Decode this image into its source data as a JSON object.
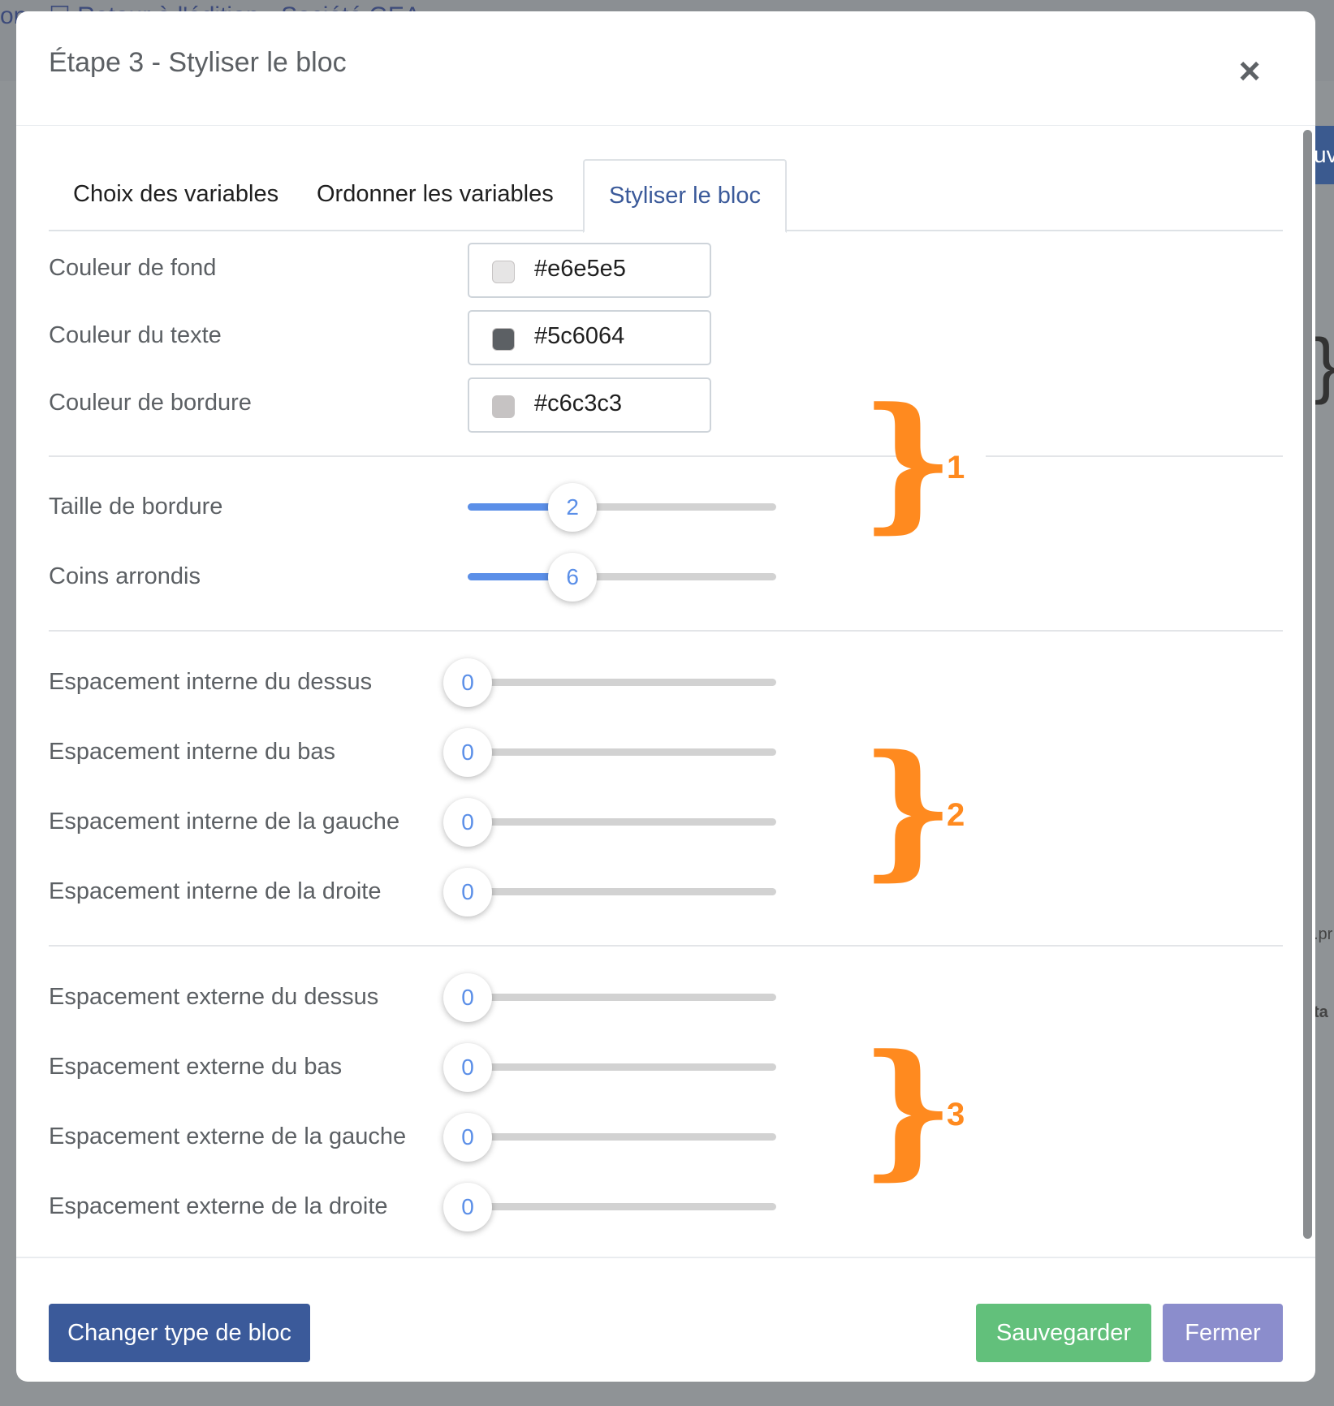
{
  "modal": {
    "title": "Étape 3 - Styliser le bloc",
    "close_icon": "×"
  },
  "tabs": [
    {
      "label": "Choix des variables",
      "active": false
    },
    {
      "label": "Ordonner les variables",
      "active": false
    },
    {
      "label": "Styliser le bloc",
      "active": true
    }
  ],
  "colors": [
    {
      "label": "Couleur de fond",
      "value": "#e6e5e5",
      "swatch": "#e6e5e5"
    },
    {
      "label": "Couleur du texte",
      "value": "#5c6064",
      "swatch": "#5c6064"
    },
    {
      "label": "Couleur de bordure",
      "value": "#c6c3c3",
      "swatch": "#c6c3c3"
    }
  ],
  "border_sliders": [
    {
      "label": "Taille de bordure",
      "value": "2",
      "fraction": 0.34
    },
    {
      "label": "Coins arrondis",
      "value": "6",
      "fraction": 0.34
    }
  ],
  "padding_sliders": [
    {
      "label": "Espacement interne du dessus",
      "value": "0",
      "fraction": 0
    },
    {
      "label": "Espacement interne du bas",
      "value": "0",
      "fraction": 0
    },
    {
      "label": "Espacement interne de la gauche",
      "value": "0",
      "fraction": 0
    },
    {
      "label": "Espacement interne de la droite",
      "value": "0",
      "fraction": 0
    }
  ],
  "margin_sliders": [
    {
      "label": "Espacement externe du dessus",
      "value": "0",
      "fraction": 0
    },
    {
      "label": "Espacement externe du bas",
      "value": "0",
      "fraction": 0
    },
    {
      "label": "Espacement externe de la gauche",
      "value": "0",
      "fraction": 0
    },
    {
      "label": "Espacement externe de la droite",
      "value": "0",
      "fraction": 0
    }
  ],
  "annotations": {
    "brace": "}",
    "group1": "1",
    "group2": "2",
    "group3": "3",
    "color": "#ff8a1f"
  },
  "footer": {
    "change_label": "Changer type de bloc",
    "save_label": "Sauvegarder",
    "close_label": "Fermer"
  },
  "background": {
    "topbar_text": "on  · ☐ Retour à l'édition · Société GEA",
    "right_button_text": "uv",
    "right_brace": "}",
    "frag_1": ".pr",
    "frag_2": "ta"
  }
}
